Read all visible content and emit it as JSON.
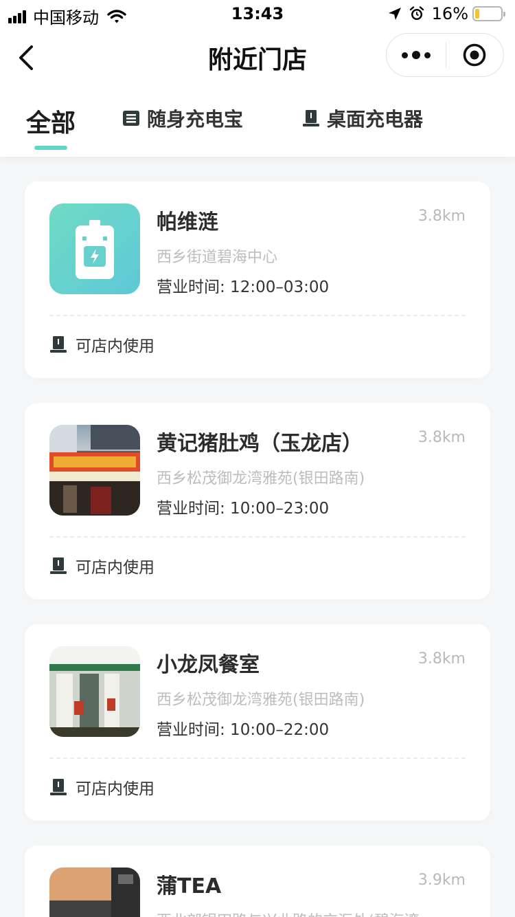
{
  "status_bar": {
    "carrier": "中国移动",
    "time": "13:43",
    "battery_percent": "16%",
    "battery_level": 0.16,
    "battery_color": "#f4c430"
  },
  "nav": {
    "title": "附近门店",
    "back_icon": "chevron-left-icon",
    "more_icon": "more-dots-icon",
    "close_icon": "target-circle-icon"
  },
  "tabs": [
    {
      "label": "全部",
      "active": true
    },
    {
      "label": "随身充电宝",
      "icon": "power-bank-icon"
    },
    {
      "label": "桌面充电器",
      "icon": "desktop-charger-icon"
    }
  ],
  "accent_color": "#5fd6c8",
  "stores": [
    {
      "name": "帕维涟",
      "distance": "3.8km",
      "address": "西乡街道碧海中心",
      "hours": "营业时间: 12:00–03:00",
      "usage": "可店内使用",
      "thumb": "battery-logo"
    },
    {
      "name": "黄记猪肚鸡（玉龙店）",
      "distance": "3.8km",
      "address": "西乡松茂御龙湾雅苑(银田路南)",
      "hours": "营业时间: 10:00–23:00",
      "usage": "可店内使用",
      "thumb": "photo"
    },
    {
      "name": "小龙凤餐室",
      "distance": "3.8km",
      "address": "西乡松茂御龙湾雅苑(银田路南)",
      "hours": "营业时间: 10:00–22:00",
      "usage": "可店内使用",
      "thumb": "photo"
    },
    {
      "name": "蒲TEA",
      "distance": "3.9km",
      "address": "西北部银田路与兴业路的交汇处(碧海湾",
      "thumb": "photo"
    }
  ]
}
